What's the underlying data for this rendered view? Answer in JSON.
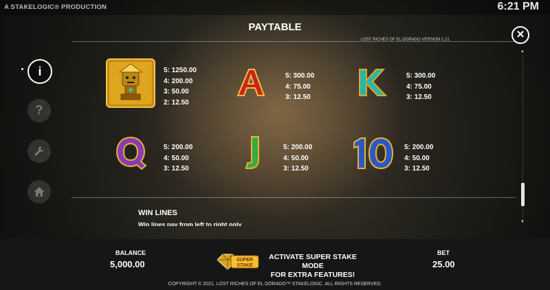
{
  "header": {
    "studio": "A STAKELOGIC® PRODUCTION",
    "clock": "6:21 PM",
    "title": "PAYTABLE",
    "version": "LOST RICHES OF EL DORADO VERSION 1.21"
  },
  "nav": {
    "info_icon": "i",
    "help_icon": "?",
    "settings_icon": "wrench",
    "home_icon": "home"
  },
  "symbols": [
    {
      "name": "idol",
      "pays": [
        "5: 1250.00",
        "4: 200.00",
        "3: 50.00",
        "2: 12.50"
      ]
    },
    {
      "name": "A",
      "pays": [
        "5: 300.00",
        "4: 75.00",
        "3: 12.50"
      ]
    },
    {
      "name": "K",
      "pays": [
        "5: 300.00",
        "4: 75.00",
        "3: 12.50"
      ]
    },
    {
      "name": "Q",
      "pays": [
        "5: 200.00",
        "4: 50.00",
        "3: 12.50"
      ]
    },
    {
      "name": "J",
      "pays": [
        "5: 200.00",
        "4: 50.00",
        "3: 12.50"
      ]
    },
    {
      "name": "10",
      "pays": [
        "5: 200.00",
        "4: 50.00",
        "3: 12.50"
      ]
    }
  ],
  "winlines": {
    "heading": "WIN LINES",
    "text": "Win lines pay from left to right only"
  },
  "footer": {
    "balance_label": "BALANCE",
    "balance_value": "5,000.00",
    "promo_line1": "ACTIVATE SUPER STAKE MODE",
    "promo_line2": "FOR EXTRA FEATURES!",
    "logo_line1": "SUPER",
    "logo_line2": "STAKE",
    "bet_label": "BET",
    "bet_value": "25.00",
    "copyright": "COPYRIGHT © 2021, LOST RICHES OF EL DORADO™ STAKELOGIC. ALL RIGHTS RESERVED."
  },
  "colors": {
    "accent_gold": "#d9a520",
    "letter_red": "#c8231e",
    "letter_teal": "#2bb5a6",
    "letter_purple": "#8a3bb3",
    "letter_green": "#3aa843",
    "letter_blue": "#2c57c9"
  }
}
